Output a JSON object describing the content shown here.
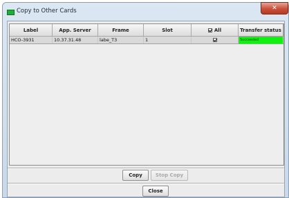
{
  "window": {
    "title": "Copy to Other Cards",
    "close_icon_glyph": "✕",
    "accent_colors": {
      "title_icon": "#1fae3a",
      "close_button": "#c9503a",
      "status_success": "#12f012"
    }
  },
  "table": {
    "headers": {
      "label": "Label",
      "app_server": "App. Server",
      "frame": "Frame",
      "slot": "Slot",
      "all": "All",
      "transfer_status": "Transfer status"
    },
    "all_checked": true,
    "rows": [
      {
        "label": "HCO-3931",
        "app_server": "10.37.31.48",
        "frame": "labe_T3",
        "slot": "1",
        "selected": true,
        "transfer_status": "Succeeded"
      }
    ]
  },
  "buttons": {
    "copy": "Copy",
    "stop_copy": "Stop Copy",
    "close": "Close"
  }
}
